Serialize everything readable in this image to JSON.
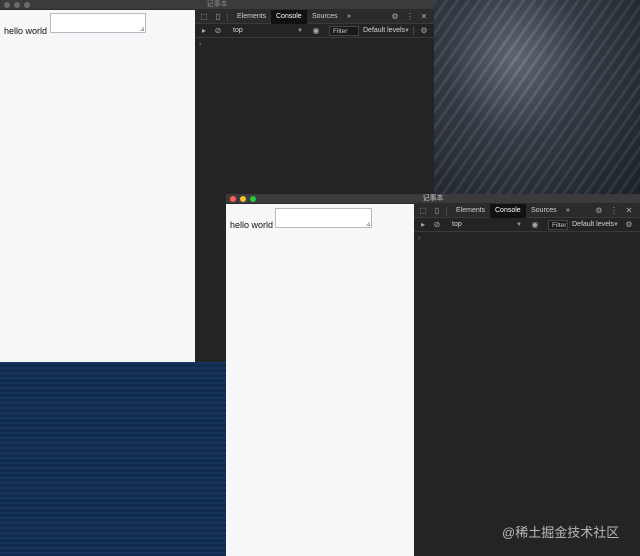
{
  "app_title": "记事本",
  "colors": {
    "close": "#ff5f57",
    "minimize": "#febc2e",
    "zoom": "#28c840",
    "devtools_bg": "#242424",
    "page_bg": "#f7f7f9"
  },
  "page": {
    "text": "hello world",
    "textarea_value": ""
  },
  "devtools": {
    "tabs": [
      "Elements",
      "Console",
      "Sources"
    ],
    "active_tab": "Console",
    "more_tabs": "»",
    "context": "top",
    "filter_placeholder": "Filter",
    "levels": "Default levels",
    "prompt": "›"
  },
  "icons": [
    "inspect-icon",
    "device-toolbar-icon",
    "settings-gear-icon",
    "more-options-icon",
    "close-icon",
    "sidebar-toggle-icon",
    "clear-console-icon",
    "eye-icon",
    "chevron-down-icon"
  ],
  "watermark": "@稀土掘金技术社区"
}
